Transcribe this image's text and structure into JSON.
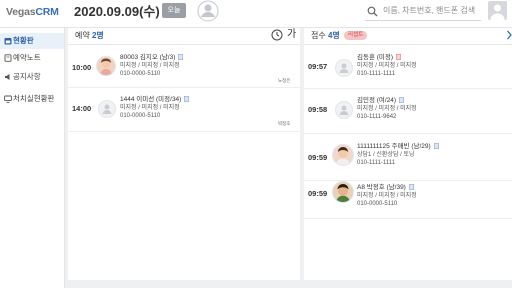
{
  "header": {
    "logo_part1": "Vegas",
    "logo_part2": "CRM",
    "date": "2020.09.09(수)",
    "today_label": "오늘",
    "search_placeholder": "이름, 차트번호, 핸드폰 검색"
  },
  "sidebar": {
    "items": [
      {
        "label": "현황판",
        "icon": "calendar-icon",
        "active": true
      },
      {
        "label": "예약노트",
        "icon": "notebook-icon",
        "active": false
      },
      {
        "label": "공지사항",
        "icon": "megaphone-icon",
        "active": false
      },
      {
        "label": "처치실현황판",
        "icon": "monitor-icon",
        "active": false
      }
    ]
  },
  "reservation": {
    "title": "예약",
    "count": "2명",
    "more": "가",
    "rows": [
      {
        "time": "10:00",
        "name": "80003 김지오 (남/3)",
        "line1": "미지정 / 미지정 / 미지정",
        "phone": "010-0000-5110",
        "staff": "노정은",
        "avatar": "child-photo"
      },
      {
        "time": "14:00",
        "name": "1444 이미선 (미정/34)",
        "line1": "미지정 / 미지정 / 미지정",
        "phone": "010-0000-5110",
        "staff": "박정호",
        "avatar": "default-avatar"
      }
    ]
  },
  "reception": {
    "title": "접수",
    "count": "4명",
    "badge": "리셉트",
    "rows": [
      {
        "time": "09:57",
        "name": "김동훈 (미정)",
        "line1": "미지정 / 미지정 / 미지정",
        "phone": "010-1111-1111",
        "avatar": "default-avatar"
      },
      {
        "time": "09:58",
        "name": "김민정 (여/24)",
        "line1": "미지정 / 미지정 / 미지정",
        "phone": "010-1111-9642",
        "avatar": "default-avatar"
      },
      {
        "time": "09:59",
        "name": "1111111125 주매빈 (남/29)",
        "line1": "상담1 / 신환상담 / 토닝",
        "phone": "010-1111-1111",
        "avatar": "man-photo"
      },
      {
        "time": "09:59",
        "name": "A8 박정호 (남/39)",
        "line1": "미지정 / 미지정 / 미지정",
        "phone": "010-0000-5110",
        "avatar": "man-photo-2"
      }
    ]
  },
  "colors": {
    "accent": "#2f63a8",
    "badge_bg": "#f4c3c3",
    "badge_text": "#c94a4a"
  }
}
